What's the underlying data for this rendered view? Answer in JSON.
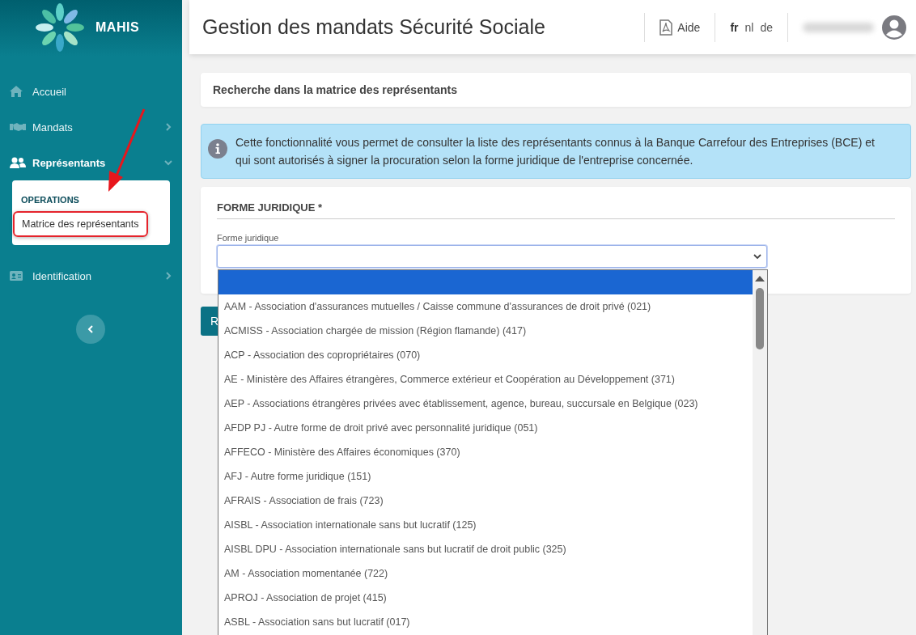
{
  "brand": {
    "name": "MAHIS"
  },
  "sidebar": {
    "items": [
      {
        "label": "Accueil",
        "kind": "home",
        "selected": false
      },
      {
        "label": "Mandats",
        "kind": "handshake",
        "selected": false,
        "expanded": false
      },
      {
        "label": "Représentants",
        "kind": "users",
        "selected": true,
        "expanded": true,
        "submenu": {
          "heading": "OPERATIONS",
          "items": [
            {
              "label": "Matrice des représentants",
              "highlighted": true
            }
          ]
        }
      },
      {
        "label": "Identification",
        "kind": "idcard",
        "selected": false,
        "expanded": false
      }
    ]
  },
  "annotation": {
    "kind": "arrow"
  },
  "header": {
    "title": "Gestion des mandats Sécurité Sociale",
    "help": "Aide",
    "languages": [
      {
        "label": "fr",
        "selected": true
      },
      {
        "label": "nl",
        "selected": false
      },
      {
        "label": "de",
        "selected": false
      }
    ]
  },
  "search_panel": {
    "title": "Recherche dans la matrice des représentants"
  },
  "info": {
    "text": "Cette fonctionnalité vous permet de consulter la liste des représentants connus à la Banque Carrefour des Entreprises (BCE) et qui sont autorisés à signer la procuration selon la forme juridique de l'entreprise concernée."
  },
  "form": {
    "section": "FORME JURIDIQUE *",
    "field_label": "Forme juridique",
    "dropdown": {
      "expanded": true,
      "options": [
        {
          "selected": true
        },
        {
          "label": "AAM - Association d'assurances mutuelles / Caisse commune d'assurances de droit privé (021)",
          "selected": false
        },
        {
          "label": "ACMISS - Association chargée de mission (Région flamande) (417)",
          "selected": false
        },
        {
          "label": "ACP - Association des copropriétaires (070)",
          "selected": false
        },
        {
          "label": "AE - Ministère des Affaires étrangères, Commerce extérieur et Coopération au Développement (371)",
          "selected": false
        },
        {
          "label": "AEP - Associations étrangères privées avec établissement, agence, bureau, succursale en Belgique (023)",
          "selected": false
        },
        {
          "label": "AFDP PJ - Autre forme de droit privé avec personnalité juridique (051)",
          "selected": false
        },
        {
          "label": "AFFECO - Ministère des Affaires économiques (370)",
          "selected": false
        },
        {
          "label": "AFJ - Autre forme juridique (151)",
          "selected": false
        },
        {
          "label": "AFRAIS - Association de frais (723)",
          "selected": false
        },
        {
          "label": "AISBL - Association internationale sans but lucratif (125)",
          "selected": false
        },
        {
          "label": "AISBL DPU - Association internationale sans but lucratif de droit public (325)",
          "selected": false
        },
        {
          "label": "AM - Association momentanée (722)",
          "selected": false
        },
        {
          "label": "APROJ - Association de projet (415)",
          "selected": false
        },
        {
          "label": "ASBL - Association sans but lucratif (017)",
          "selected": false
        }
      ]
    }
  },
  "action_button": {
    "label": "R"
  }
}
